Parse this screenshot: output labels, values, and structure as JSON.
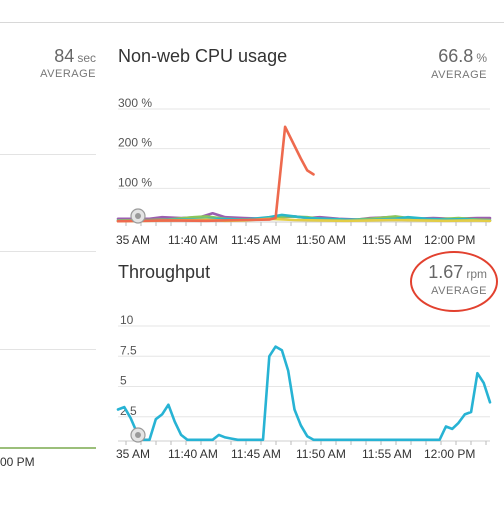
{
  "left_panel": {
    "metric_value": "84",
    "metric_unit": "sec",
    "metric_label": "AVERAGE",
    "x_tick": "00 PM"
  },
  "cpu_panel": {
    "title": "Non-web CPU usage",
    "metric_value": "66.8",
    "metric_unit": "%",
    "metric_label": "AVERAGE"
  },
  "throughput_panel": {
    "title": "Throughput",
    "metric_value": "1.67",
    "metric_unit": "rpm",
    "metric_label": "AVERAGE"
  },
  "colors": {
    "cpu_orange": "#ee6a4e",
    "cpu_purple": "#9b5fb0",
    "cpu_green": "#8cc55a",
    "cpu_teal": "#2bb7c7",
    "cpu_yellow": "#e3cd46",
    "throughput": "#27b3d4",
    "annotation": "#e2412f"
  },
  "chart_data": [
    {
      "type": "line",
      "title": "Non-web CPU usage",
      "x_tick_labels": [
        "35 AM",
        "11:40 AM",
        "11:45 AM",
        "11:50 AM",
        "11:55 AM",
        "12:00 PM"
      ],
      "y_tick_labels": [
        "300 %",
        "200 %",
        "100 %"
      ],
      "y_ticks": [
        300,
        200,
        100
      ],
      "ylim": [
        0,
        300
      ],
      "xlim": [
        0,
        59
      ],
      "series": [
        {
          "color": "#9b5fb0",
          "x": [
            0,
            5,
            7,
            10,
            13,
            15,
            17,
            20,
            23,
            26,
            28,
            30,
            32,
            35,
            38,
            40,
            43,
            47,
            50,
            53,
            57,
            59
          ],
          "values": [
            8,
            8,
            12,
            10,
            12,
            22,
            12,
            10,
            8,
            12,
            14,
            10,
            12,
            8,
            6,
            10,
            12,
            8,
            10,
            8,
            10,
            10
          ]
        },
        {
          "color": "#8cc55a",
          "x": [
            0,
            5,
            8,
            12,
            14,
            17,
            20,
            24,
            27,
            30,
            33,
            36,
            40,
            44,
            47,
            50,
            54,
            57,
            59
          ],
          "values": [
            4,
            5,
            6,
            12,
            14,
            8,
            6,
            10,
            14,
            12,
            6,
            5,
            8,
            14,
            8,
            6,
            10,
            6,
            5
          ]
        },
        {
          "color": "#2bb7c7",
          "x": [
            0,
            6,
            10,
            15,
            20,
            24,
            26,
            28,
            30,
            33,
            36,
            40,
            44,
            46,
            49,
            52,
            55,
            57,
            59
          ],
          "values": [
            3,
            4,
            6,
            8,
            6,
            12,
            18,
            14,
            10,
            8,
            6,
            5,
            8,
            12,
            8,
            6,
            7,
            5,
            4
          ]
        },
        {
          "color": "#e3cd46",
          "x": [
            0,
            5,
            8,
            12,
            14,
            17,
            20,
            24,
            28,
            32,
            36,
            40,
            44,
            48,
            52,
            56,
            59
          ],
          "values": [
            2,
            3,
            4,
            5,
            6,
            3,
            4,
            8,
            5,
            4,
            3,
            4,
            5,
            4,
            3,
            4,
            3
          ]
        },
        {
          "color": "#ee6a4e",
          "x": [
            0,
            8,
            14,
            20,
            24,
            25,
            26.5,
            29,
            30,
            31
          ],
          "values": [
            2,
            4,
            3,
            5,
            6,
            10,
            240,
            160,
            130,
            120
          ]
        }
      ]
    },
    {
      "type": "line",
      "title": "Throughput",
      "x_tick_labels": [
        "35 AM",
        "11:40 AM",
        "11:45 AM",
        "11:50 AM",
        "11:55 AM",
        "12:00 PM"
      ],
      "y_tick_labels": [
        "10",
        "7.5",
        "5",
        "2.5"
      ],
      "y_ticks": [
        10,
        7.5,
        5,
        2.5
      ],
      "ylim": [
        0,
        10
      ],
      "xlim": [
        0,
        59
      ],
      "series": [
        {
          "color": "#27b3d4",
          "x": [
            0,
            1,
            2,
            3,
            4,
            5,
            6,
            7,
            8,
            9,
            10,
            11,
            12,
            13,
            14,
            15,
            16,
            17,
            18,
            19,
            20,
            21,
            22,
            23,
            24,
            25,
            26,
            27,
            28,
            29,
            30,
            31,
            32,
            33,
            34,
            35,
            36,
            37,
            38,
            39,
            40,
            41,
            42,
            43,
            44,
            45,
            46,
            47,
            48,
            49,
            50,
            51,
            52,
            53,
            54,
            55,
            56,
            57,
            58,
            59
          ],
          "values": [
            2.6,
            2.8,
            1.9,
            0.7,
            0.1,
            0.1,
            1.8,
            2.2,
            3.0,
            1.6,
            0.5,
            0.1,
            0.1,
            0.1,
            0.1,
            0.1,
            0.5,
            0.3,
            0.2,
            0.1,
            0.1,
            0.1,
            0.1,
            0.1,
            7.0,
            7.8,
            7.5,
            5.8,
            2.6,
            1.3,
            0.4,
            0.1,
            0.1,
            0.1,
            0.1,
            0.1,
            0.1,
            0.1,
            0.1,
            0.1,
            0.1,
            0.1,
            0.1,
            0.1,
            0.1,
            0.1,
            0.1,
            0.1,
            0.1,
            0.1,
            0.1,
            0.1,
            1.2,
            1.0,
            1.5,
            2.2,
            2.4,
            5.6,
            4.8,
            3.2
          ]
        }
      ]
    }
  ]
}
